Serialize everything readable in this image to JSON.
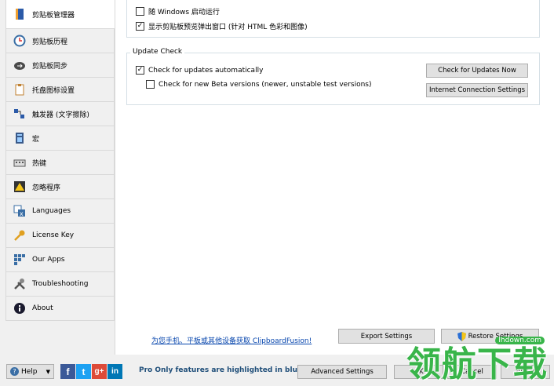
{
  "sidebar": {
    "items": [
      {
        "label": "剪贴板管理器",
        "icon": "book-icon"
      },
      {
        "label": "剪贴板历程",
        "icon": "clock-icon"
      },
      {
        "label": "剪贴板同步",
        "icon": "cloud-sync-icon"
      },
      {
        "label": "托盘图标设置",
        "icon": "clipboard-icon"
      },
      {
        "label": "触发器 (文字擦除)",
        "icon": "trigger-icon"
      },
      {
        "label": "宏",
        "icon": "macro-icon"
      },
      {
        "label": "热键",
        "icon": "keyboard-icon"
      },
      {
        "label": "忽略程序",
        "icon": "warning-icon"
      },
      {
        "label": "Languages",
        "icon": "language-icon"
      },
      {
        "label": "License Key",
        "icon": "key-icon"
      },
      {
        "label": "Our Apps",
        "icon": "apps-icon"
      },
      {
        "label": "Troubleshooting",
        "icon": "tools-icon"
      },
      {
        "label": "About",
        "icon": "info-icon"
      }
    ]
  },
  "general": {
    "startup_label": "随 Windows 启动运行",
    "startup_checked": false,
    "preview_label": "显示剪贴板预览弹出窗口 (针对 HTML 色彩和图像)",
    "preview_checked": true
  },
  "update_check": {
    "title": "Update Check",
    "auto_label": "Check for updates automatically",
    "auto_checked": true,
    "beta_label": "Check for new Beta versions (newer, unstable test versions)",
    "beta_checked": false,
    "check_now_label": "Check for Updates Now",
    "internet_settings_label": "Internet Connection Settings"
  },
  "footer_link": "为您手机、平板或其他设备获取 ClipboardFusion!",
  "export_label": "Export Settings",
  "restore_label": "Restore Settings",
  "bottom": {
    "help_label": "Help",
    "pro_text": "Pro Only features are highlighted in blue",
    "advanced_label": "Advanced Settings",
    "ok_label": "OK",
    "cancel_label": "Cancel",
    "apply_label": "Apply"
  },
  "watermark": {
    "text": "领航下载",
    "url": "lhdown.com"
  },
  "colors": {
    "pro_text": "#1f4e79",
    "link": "#0645ad",
    "watermark_green": "#39b54a"
  }
}
